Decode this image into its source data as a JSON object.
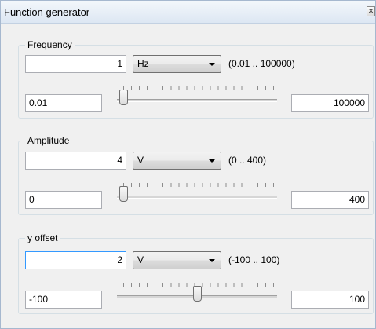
{
  "window": {
    "title": "Function generator",
    "close_glyph": "✕"
  },
  "groups": [
    {
      "label": "Frequency",
      "value": "1",
      "unit": "Hz",
      "range_text": "(0.01 .. 100000)",
      "min": "0.01",
      "max": "100000",
      "slider_fraction": 0.0
    },
    {
      "label": "Amplitude",
      "value": "4",
      "unit": "V",
      "range_text": "(0 .. 400)",
      "min": "0",
      "max": "400",
      "slider_fraction": 0.0
    },
    {
      "label": "y offset",
      "value": "2",
      "unit": "V",
      "range_text": "(-100 .. 100)",
      "min": "-100",
      "max": "100",
      "slider_fraction": 0.5
    }
  ],
  "icons": {
    "close": "close-icon",
    "dropdown": "chevron-down-icon"
  }
}
